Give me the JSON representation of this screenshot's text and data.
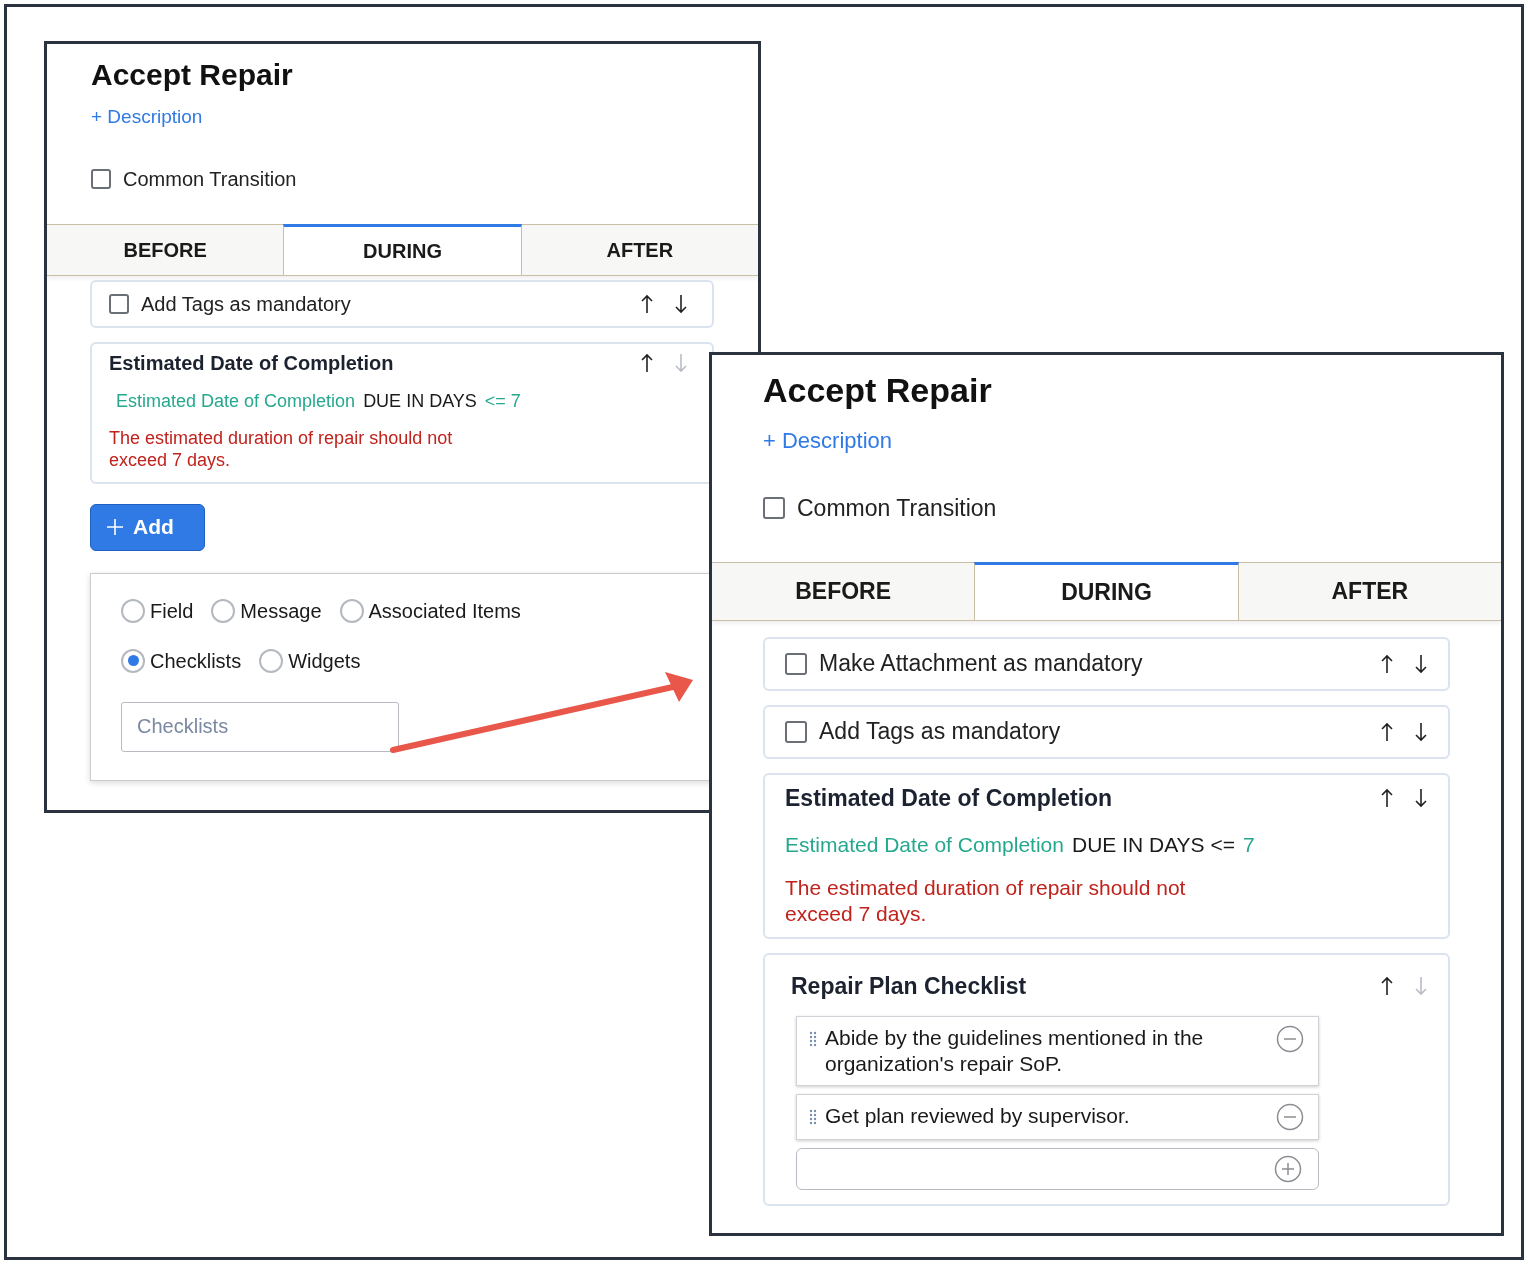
{
  "panels": [
    {
      "title": "Accept Repair",
      "description_link": "+ Description",
      "common_transition": {
        "label": "Common Transition",
        "checked": false
      },
      "tabs": [
        {
          "label": "BEFORE",
          "selected": false
        },
        {
          "label": "DURING",
          "selected": true
        },
        {
          "label": "AFTER",
          "selected": false
        }
      ],
      "cards": [
        {
          "kind": "toggle",
          "label": "Add Tags as mandatory",
          "checked": false,
          "down_enabled": true
        },
        {
          "kind": "condition",
          "title": "Estimated Date of Completion",
          "field": "Estimated Date of Completion",
          "operator": "DUE IN DAYS",
          "value": "<= 7",
          "message": "The estimated duration of repair should not exceed 7 days.",
          "down_enabled": false
        }
      ],
      "add_button": "Add",
      "add_menu": {
        "options": [
          {
            "label": "Field",
            "selected": false
          },
          {
            "label": "Message",
            "selected": false
          },
          {
            "label": "Associated Items",
            "selected": false
          },
          {
            "label": "Checklists",
            "selected": true
          },
          {
            "label": "Widgets",
            "selected": false
          }
        ],
        "input_placeholder": "Checklists"
      }
    },
    {
      "title": "Accept Repair",
      "description_link": "+ Description",
      "common_transition": {
        "label": "Common Transition",
        "checked": false
      },
      "tabs": [
        {
          "label": "BEFORE",
          "selected": false
        },
        {
          "label": "DURING",
          "selected": true
        },
        {
          "label": "AFTER",
          "selected": false
        }
      ],
      "cards": [
        {
          "kind": "toggle",
          "label": "Make Attachment as mandatory",
          "checked": false,
          "down_enabled": true
        },
        {
          "kind": "toggle",
          "label": "Add Tags as mandatory",
          "checked": false,
          "down_enabled": true
        },
        {
          "kind": "condition",
          "title": "Estimated Date of Completion",
          "field": "Estimated Date of Completion",
          "operator": "DUE IN DAYS <=",
          "value": "7",
          "message": "The estimated duration of repair should not exceed 7 days.",
          "down_enabled": true
        },
        {
          "kind": "checklist",
          "title": "Repair Plan Checklist",
          "items": [
            "Abide by the guidelines mentioned in the organization's repair SoP.",
            "Get plan reviewed by supervisor."
          ],
          "down_enabled": false
        }
      ]
    }
  ]
}
